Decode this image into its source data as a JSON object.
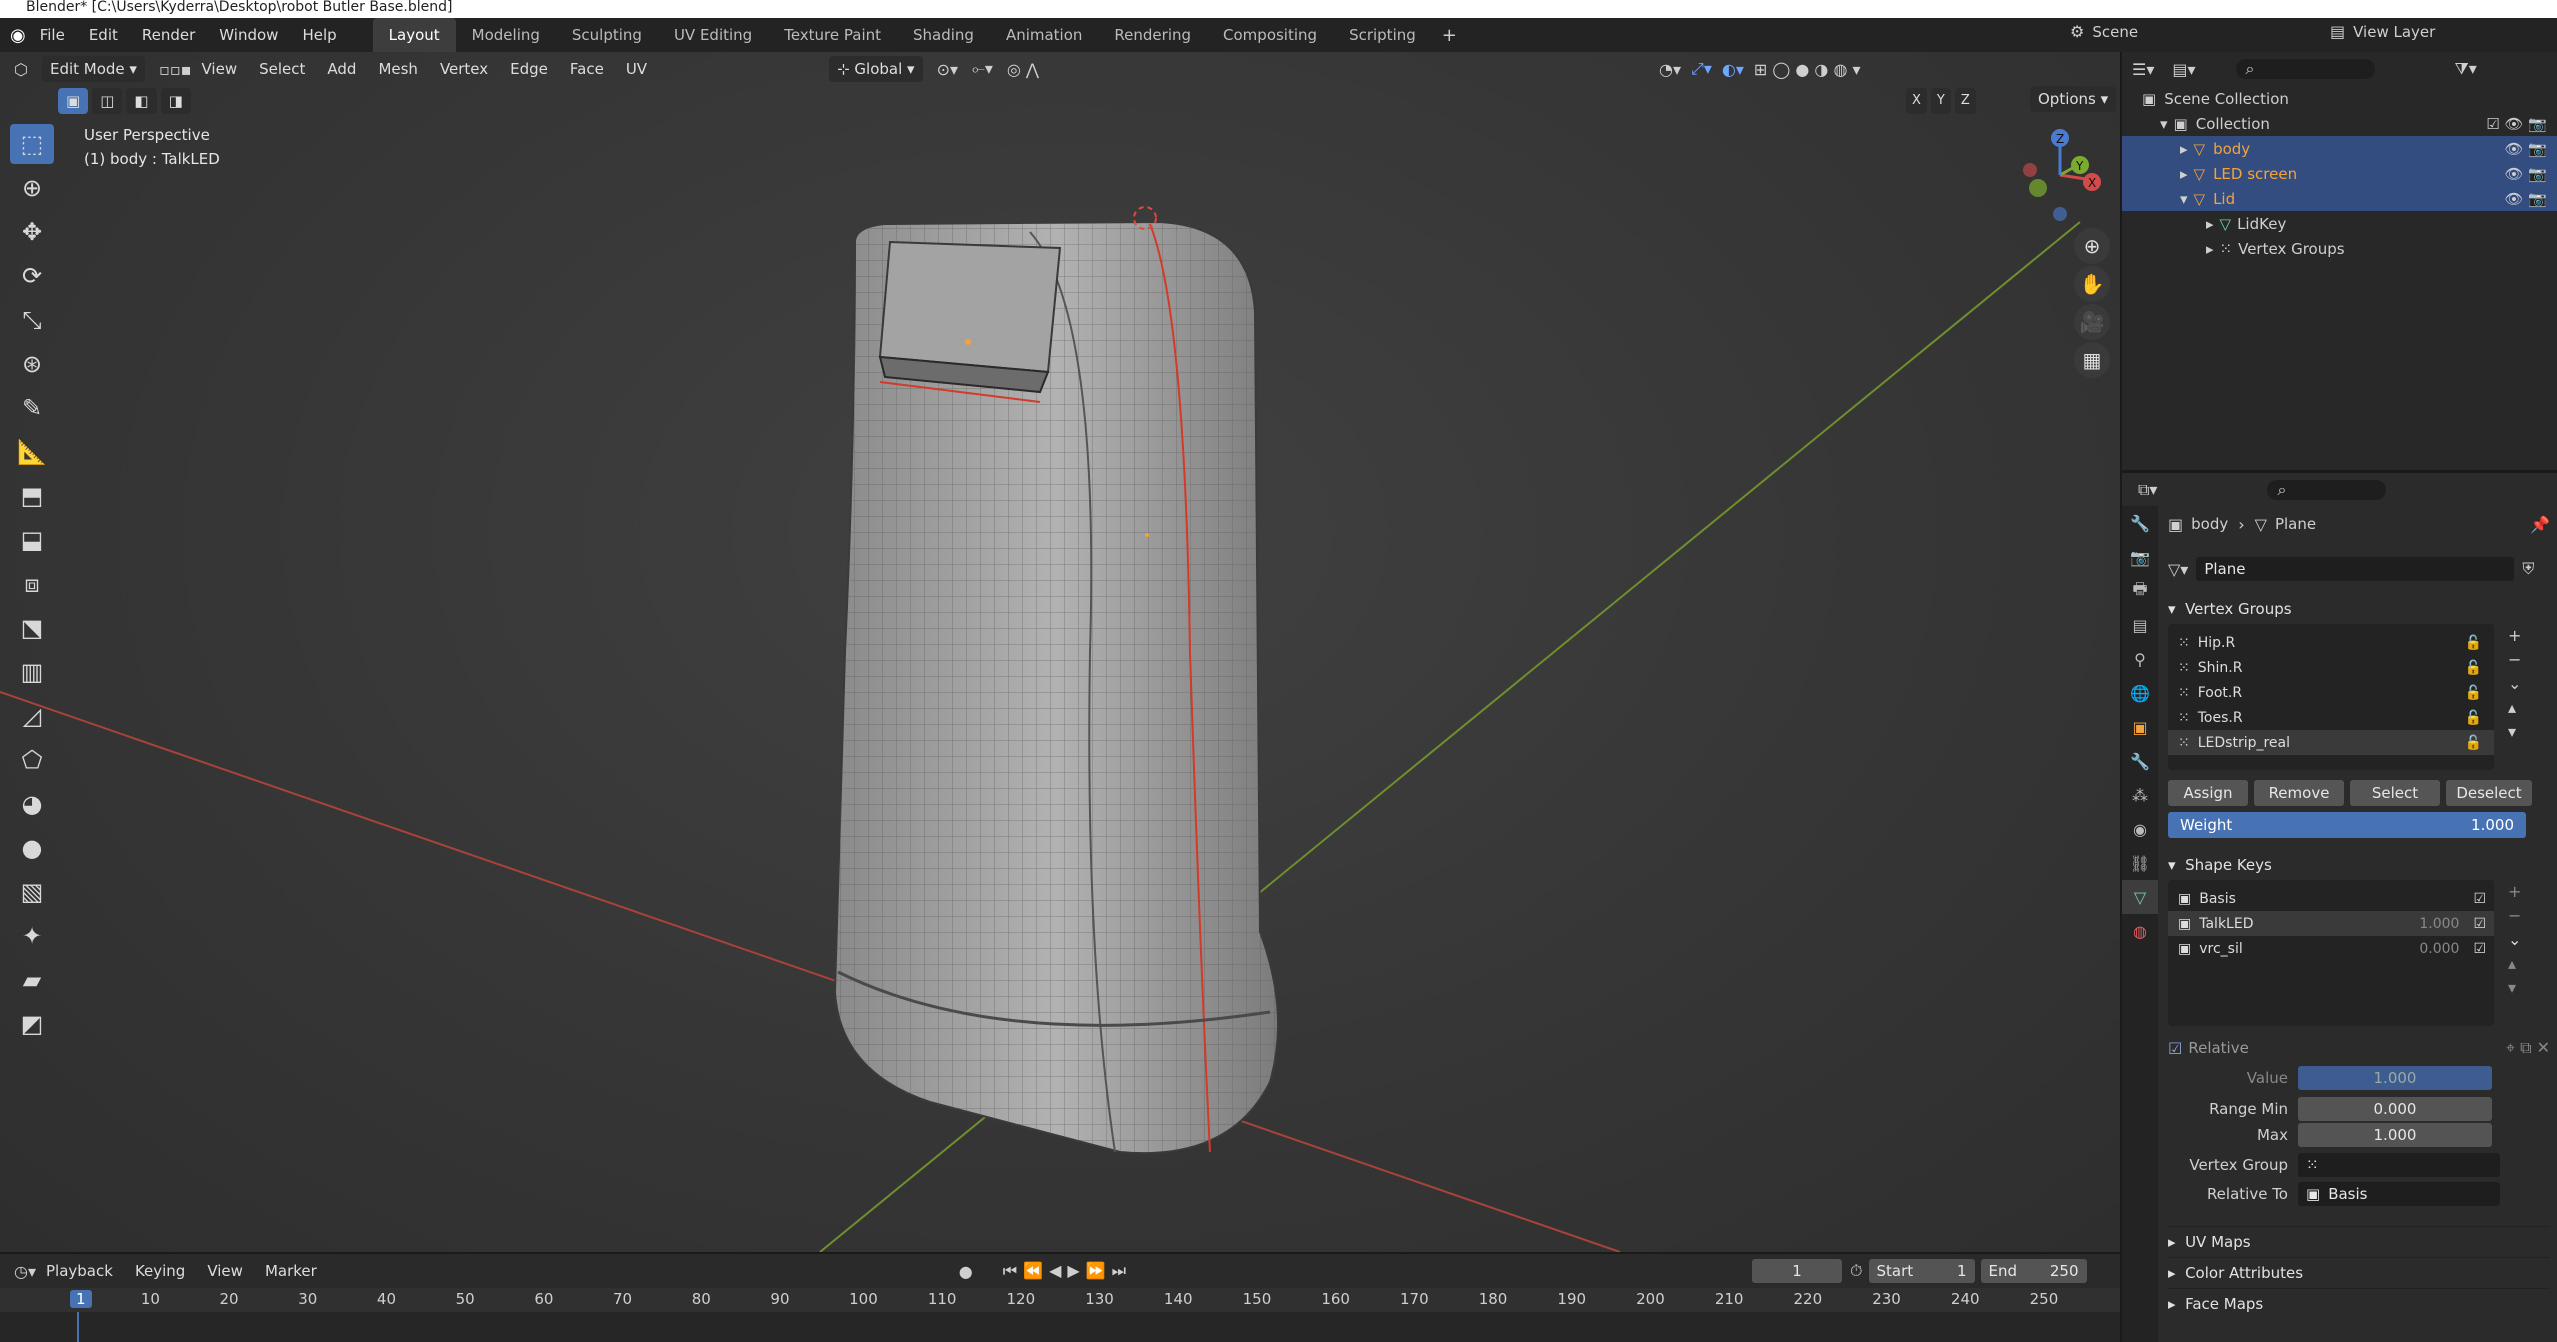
{
  "window": {
    "title": "Blender* [C:\\Users\\Kyderra\\Desktop\\robot Butler Base.blend]"
  },
  "menu": [
    "File",
    "Edit",
    "Render",
    "Window",
    "Help"
  ],
  "workspaces": [
    "Layout",
    "Modeling",
    "Sculpting",
    "UV Editing",
    "Texture Paint",
    "Shading",
    "Animation",
    "Rendering",
    "Compositing",
    "Scripting"
  ],
  "active_workspace": "Layout",
  "scene": {
    "label": "Scene",
    "view_layer": "View Layer"
  },
  "viewport": {
    "mode": "Edit Mode",
    "menus": [
      "View",
      "Select",
      "Add",
      "Mesh",
      "Vertex",
      "Edge",
      "Face",
      "UV"
    ],
    "orientation": "Global",
    "options": "Options",
    "axes": [
      "X",
      "Y",
      "Z"
    ],
    "overlay_title": "User Perspective",
    "overlay_subtitle": "(1) body : TalkLED",
    "gizmo_labels": {
      "x": "X",
      "y": "Y",
      "z": "Z"
    }
  },
  "outliner": {
    "scene_collection": "Scene Collection",
    "collection": "Collection",
    "items": [
      {
        "label": "body",
        "selected": true,
        "color": "#f5a23a"
      },
      {
        "label": "LED screen",
        "selected": true,
        "color": "#f5a23a"
      },
      {
        "label": "Lid",
        "selected": true,
        "color": "#f5a23a"
      }
    ],
    "children": [
      "LidKey",
      "Vertex Groups"
    ]
  },
  "properties": {
    "breadcrumb": {
      "object": "body",
      "data": "Plane"
    },
    "mesh_name": "Plane",
    "vertex_groups": {
      "title": "Vertex Groups",
      "items": [
        "Hip.R",
        "Shin.R",
        "Foot.R",
        "Toes.R",
        "LEDstrip_real"
      ],
      "selected": "LEDstrip_real",
      "buttons": [
        "Assign",
        "Remove",
        "Select",
        "Deselect"
      ],
      "weight_label": "Weight",
      "weight_value": "1.000"
    },
    "shape_keys": {
      "title": "Shape Keys",
      "items": [
        {
          "label": "Basis",
          "value": ""
        },
        {
          "label": "TalkLED",
          "value": "1.000"
        },
        {
          "label": "vrc_sil",
          "value": "0.000"
        }
      ],
      "relative_label": "Relative",
      "value_label": "Value",
      "value_value": "1.000",
      "range_min_label": "Range Min",
      "range_min_value": "0.000",
      "max_label": "Max",
      "max_value": "1.000",
      "vertex_group_label": "Vertex Group",
      "relative_to_label": "Relative To",
      "relative_to_value": "Basis"
    },
    "collapsed_panels": [
      "UV Maps",
      "Color Attributes",
      "Face Maps"
    ]
  },
  "timeline": {
    "menus": [
      "Playback",
      "Keying",
      "View",
      "Marker"
    ],
    "current_frame": "1",
    "start_label": "Start",
    "start_value": "1",
    "end_label": "End",
    "end_value": "250",
    "ticks": [
      "1",
      "10",
      "20",
      "30",
      "40",
      "50",
      "60",
      "70",
      "80",
      "90",
      "100",
      "110",
      "120",
      "130",
      "140",
      "150",
      "160",
      "170",
      "180",
      "190",
      "200",
      "210",
      "220",
      "230",
      "240",
      "250"
    ]
  },
  "colors": {
    "accent": "#4772b3",
    "selection": "#334d80",
    "object_orange": "#f5a23a",
    "x_axis": "#c0392b",
    "y_axis": "#7bab2e"
  }
}
